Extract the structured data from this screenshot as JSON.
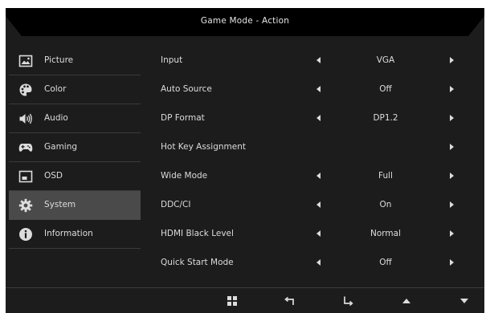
{
  "header": {
    "title": "Game Mode - Action"
  },
  "sidebar": {
    "items": [
      {
        "label": "Picture",
        "icon": "picture-icon",
        "active": false
      },
      {
        "label": "Color",
        "icon": "palette-icon",
        "active": false
      },
      {
        "label": "Audio",
        "icon": "speaker-icon",
        "active": false
      },
      {
        "label": "Gaming",
        "icon": "gamepad-icon",
        "active": false
      },
      {
        "label": "OSD",
        "icon": "osd-window-icon",
        "active": false
      },
      {
        "label": "System",
        "icon": "gear-icon",
        "active": true
      },
      {
        "label": "Information",
        "icon": "info-icon",
        "active": false
      }
    ]
  },
  "settings": {
    "rows": [
      {
        "label": "Input",
        "value": "VGA",
        "has_left_arrow": true
      },
      {
        "label": "Auto Source",
        "value": "Off",
        "has_left_arrow": true
      },
      {
        "label": "DP Format",
        "value": "DP1.2",
        "has_left_arrow": true
      },
      {
        "label": "Hot Key Assignment",
        "value": "",
        "has_left_arrow": false
      },
      {
        "label": "Wide Mode",
        "value": "Full",
        "has_left_arrow": true
      },
      {
        "label": "DDC/CI",
        "value": "On",
        "has_left_arrow": true
      },
      {
        "label": "HDMI Black Level",
        "value": "Normal",
        "has_left_arrow": true
      },
      {
        "label": "Quick Start Mode",
        "value": "Off",
        "has_left_arrow": true
      }
    ]
  },
  "footer": {
    "buttons": [
      "menu-grid-icon",
      "back-icon",
      "enter-icon",
      "up-icon",
      "down-icon"
    ]
  },
  "colors": {
    "panel_background": "#1c1c1c",
    "header_background": "#000000",
    "active_item": "#4a4a4a",
    "text": "#dcdcdc",
    "divider": "#3a3a3a"
  }
}
